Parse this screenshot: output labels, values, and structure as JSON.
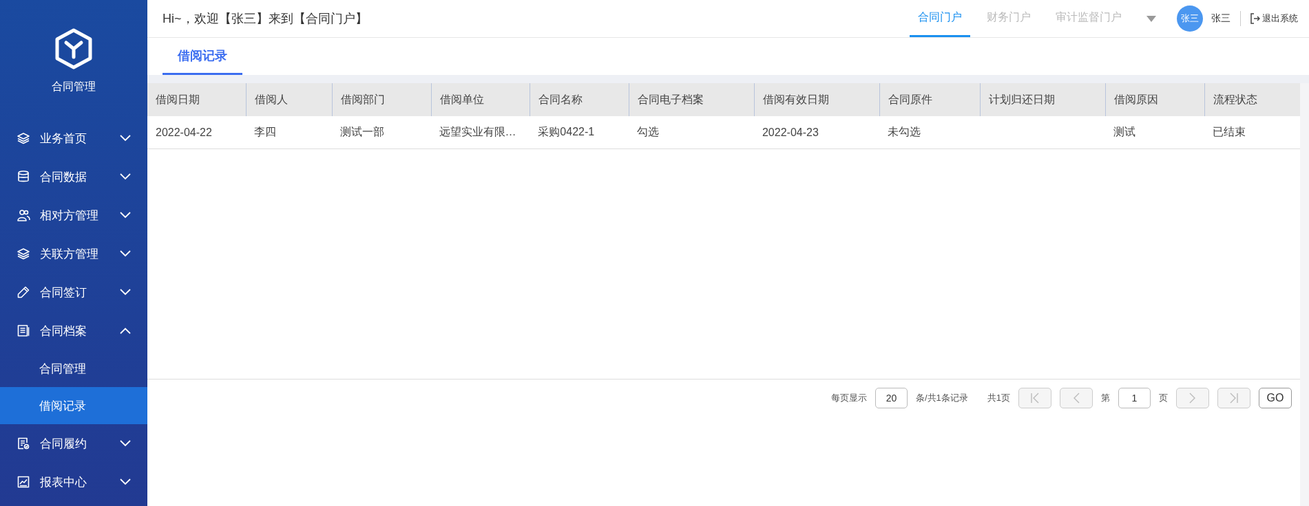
{
  "sidebar": {
    "app_title": "合同管理",
    "items": [
      {
        "label": "业务首页",
        "expanded": false
      },
      {
        "label": "合同数据",
        "expanded": false
      },
      {
        "label": "相对方管理",
        "expanded": false
      },
      {
        "label": "关联方管理",
        "expanded": false
      },
      {
        "label": "合同签订",
        "expanded": false
      },
      {
        "label": "合同档案",
        "expanded": true,
        "children": [
          {
            "label": "合同管理",
            "selected": false
          },
          {
            "label": "借阅记录",
            "selected": true
          }
        ]
      },
      {
        "label": "合同履约",
        "expanded": false
      },
      {
        "label": "报表中心",
        "expanded": false
      }
    ]
  },
  "header": {
    "greeting": "Hi~，欢迎【张三】来到【合同门户】",
    "portals": [
      {
        "label": "合同门户",
        "selected": true
      },
      {
        "label": "财务门户",
        "selected": false
      },
      {
        "label": "审计监督门户",
        "selected": false
      }
    ],
    "avatar_text": "张三",
    "user_name": "张三",
    "logout": "退出系统"
  },
  "tabs": [
    {
      "label": "借阅记录",
      "selected": true
    }
  ],
  "table": {
    "columns": [
      "借阅日期",
      "借阅人",
      "借阅部门",
      "借阅单位",
      "合同名称",
      "合同电子档案",
      "借阅有效日期",
      "合同原件",
      "计划归还日期",
      "借阅原因",
      "流程状态"
    ],
    "rows": [
      [
        "2022-04-22",
        "李四",
        "测试一部",
        "远望实业有限…",
        "采购0422-1",
        "勾选",
        "2022-04-23",
        "未勾选",
        "",
        "测试",
        "已结束"
      ]
    ]
  },
  "pagination": {
    "per_page_label": "每页显示",
    "page_size": "20",
    "records_label": "条/共1条记录",
    "pages_label": "共1页",
    "first_disabled": true,
    "prev_disabled": true,
    "page_prefix": "第",
    "page": "1",
    "page_suffix": "页",
    "next_disabled": true,
    "last_disabled": true,
    "go": "GO"
  }
}
